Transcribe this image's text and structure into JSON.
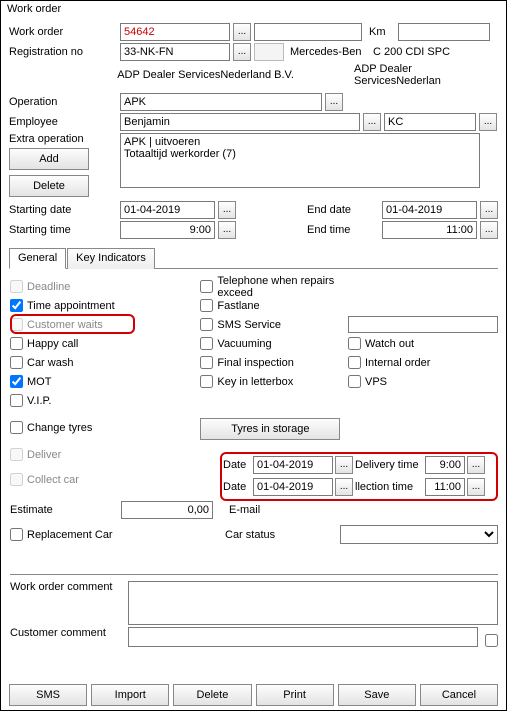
{
  "window": {
    "title": "Work order"
  },
  "labels": {
    "work_order": "Work order",
    "km": "Km",
    "registration": "Registration no",
    "operation": "Operation",
    "employee": "Employee",
    "extra_op": "Extra operation",
    "add": "Add",
    "delete": "Delete",
    "start_date": "Starting date",
    "end_date": "End date",
    "start_time": "Starting time",
    "end_time": "End time",
    "general": "General",
    "key_ind": "Key Indicators",
    "deadline": "Deadline",
    "time_appt": "Time appointment",
    "cust_waits": "Customer waits",
    "happy_call": "Happy call",
    "car_wash": "Car wash",
    "mot": "MOT",
    "vip": "V.I.P.",
    "change_tyres": "Change tyres",
    "tel_exceed": "Telephone when repairs exceed",
    "fastlane": "Fastlane",
    "sms_service": "SMS Service",
    "vacuuming": "Vacuuming",
    "final_insp": "Final inspection",
    "key_letterbox": "Key in letterbox",
    "watch_out": "Watch out",
    "internal_order": "Internal order",
    "vps": "VPS",
    "tyres_storage": "Tyres in storage",
    "deliver": "Deliver",
    "collect": "Collect car",
    "date": "Date",
    "delivery_time": "Delivery time",
    "collection_time": "llection time",
    "estimate": "Estimate",
    "email": "E-mail",
    "repl_car": "Replacement Car",
    "car_status": "Car status",
    "wo_comment": "Work order comment",
    "cust_comment": "Customer comment",
    "sms": "SMS",
    "import": "Import",
    "print": "Print",
    "save": "Save",
    "cancel": "Cancel"
  },
  "values": {
    "work_order_no": "54642",
    "registration": "33-NK-FN",
    "make": "Mercedes-Ben",
    "model": "C 200 CDI SPC",
    "dealer1": "ADP Dealer ServicesNederland B.V.",
    "dealer2": "ADP Dealer ServicesNederlan",
    "operation": "APK",
    "employee": "Benjamin",
    "employee_code": "KC",
    "extra_ops": "APK | uitvoeren\nTotaaltijd werkorder (7)",
    "start_date": "01-04-2019",
    "end_date": "01-04-2019",
    "start_time": "9:00",
    "end_time": "11:00",
    "deliver_date": "01-04-2019",
    "deliver_time": "9:00",
    "collect_date": "01-04-2019",
    "collect_time": "11:00",
    "estimate": "0,00",
    "km": ""
  },
  "checks": {
    "time_appt": true,
    "mot": true
  },
  "dots": "..."
}
